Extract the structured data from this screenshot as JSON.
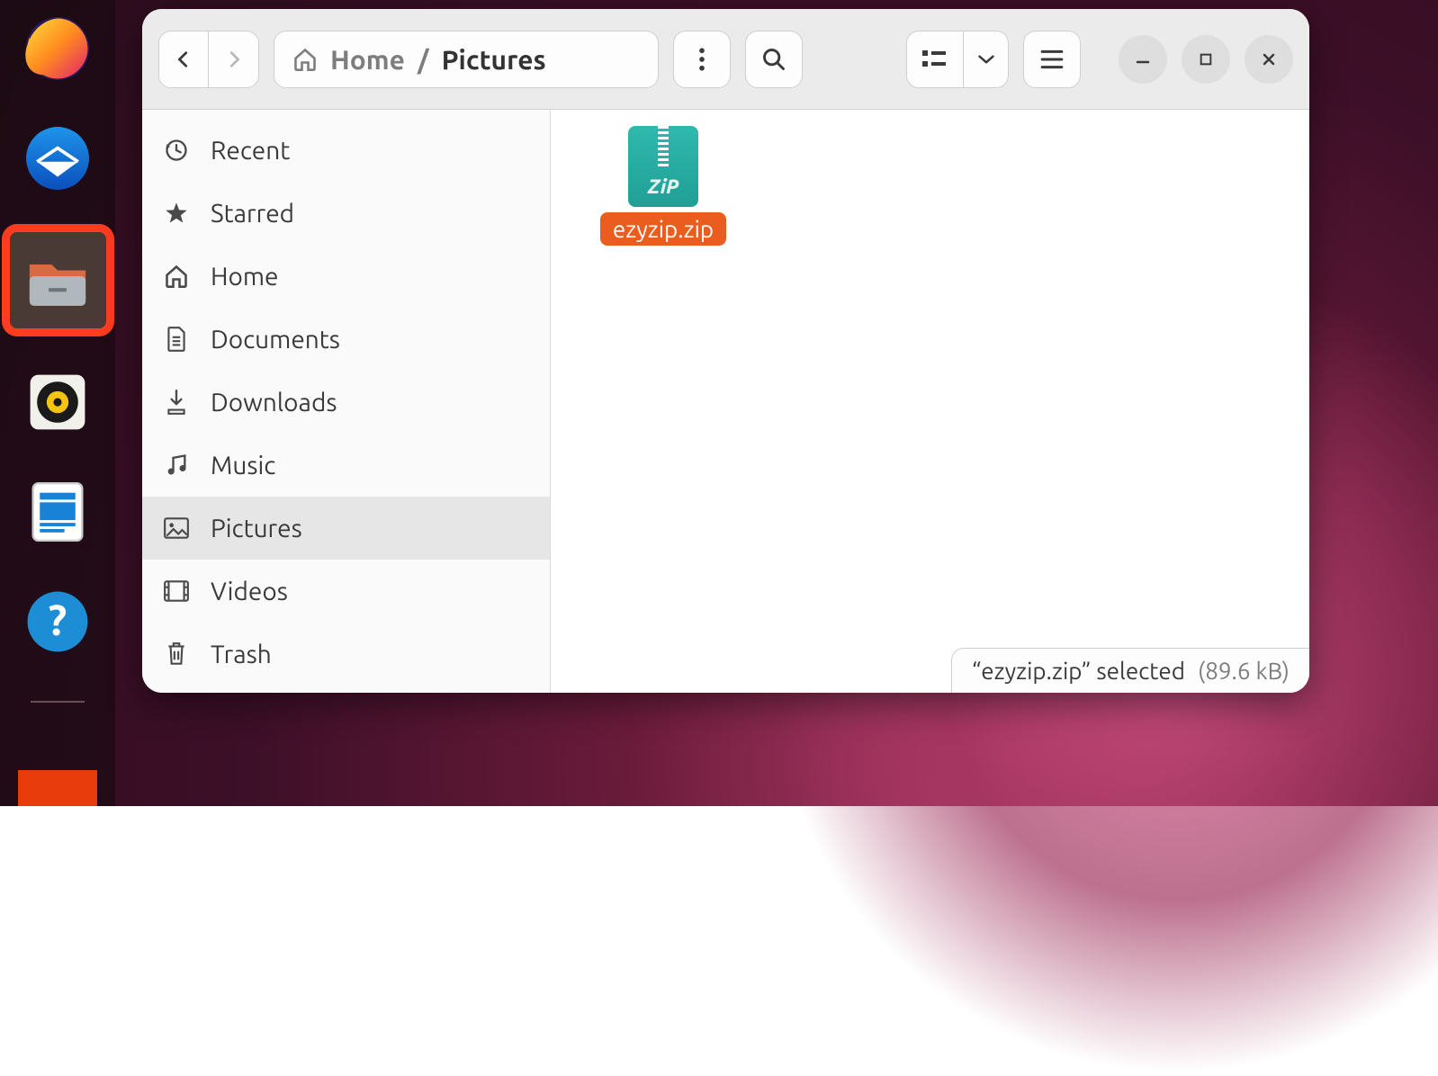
{
  "dock": {
    "items": [
      {
        "name": "firefox",
        "highlight": false
      },
      {
        "name": "thunderbird",
        "highlight": false
      },
      {
        "name": "files",
        "highlight": true
      },
      {
        "name": "rhythmbox",
        "highlight": false
      },
      {
        "name": "libreoffice-writer",
        "highlight": false
      },
      {
        "name": "help",
        "highlight": false
      }
    ]
  },
  "breadcrumb": {
    "parent": "Home",
    "separator": "/",
    "current": "Pictures"
  },
  "sidebar": {
    "items": [
      {
        "icon": "recent",
        "label": "Recent",
        "active": false
      },
      {
        "icon": "starred",
        "label": "Starred",
        "active": false
      },
      {
        "icon": "home",
        "label": "Home",
        "active": false
      },
      {
        "icon": "documents",
        "label": "Documents",
        "active": false
      },
      {
        "icon": "downloads",
        "label": "Downloads",
        "active": false
      },
      {
        "icon": "music",
        "label": "Music",
        "active": false
      },
      {
        "icon": "pictures",
        "label": "Pictures",
        "active": true
      },
      {
        "icon": "videos",
        "label": "Videos",
        "active": false
      },
      {
        "icon": "trash",
        "label": "Trash",
        "active": false
      }
    ]
  },
  "content": {
    "files": [
      {
        "name": "ezyzip.zip",
        "icon_label": "ZiP",
        "selected": true
      }
    ]
  },
  "status": {
    "text": "“ezyzip.zip” selected",
    "size": "(89.6 kB)"
  },
  "colors": {
    "accent": "#eb5c1f",
    "highlight": "#ff3b20"
  }
}
